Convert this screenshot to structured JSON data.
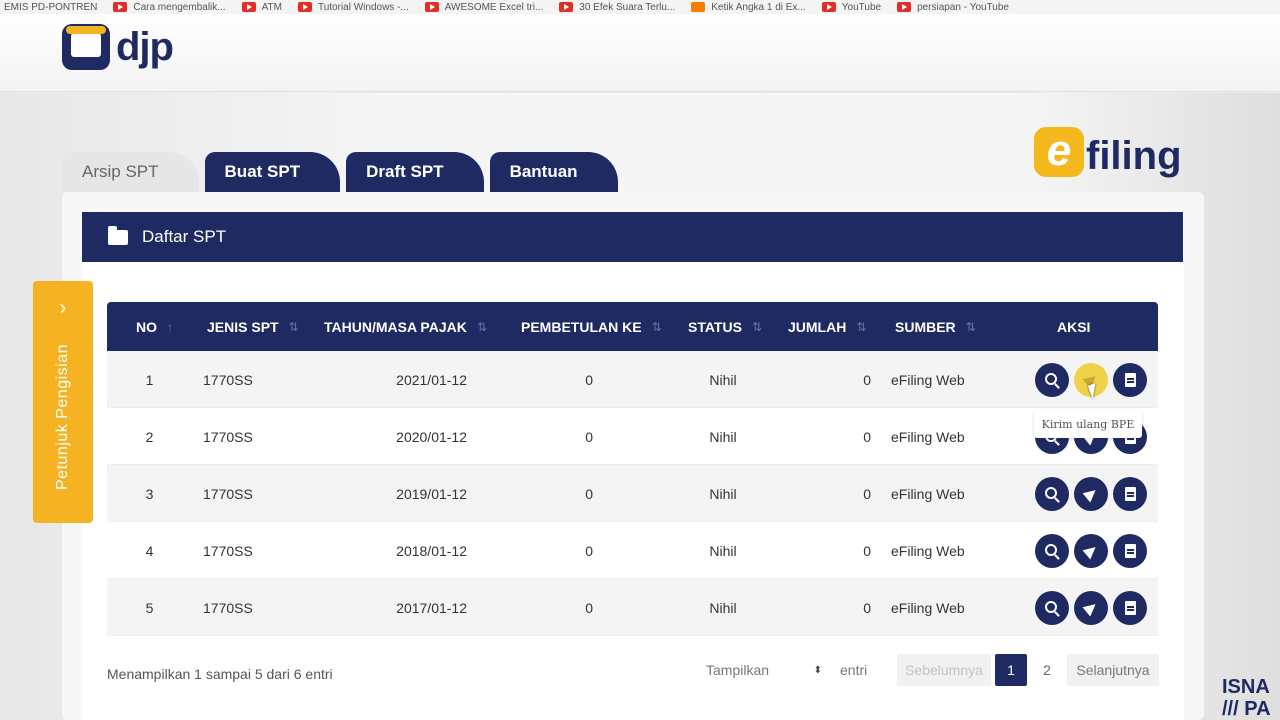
{
  "bookmarks": [
    {
      "label": "EMIS PD-PONTREN",
      "icon": "none"
    },
    {
      "label": "Cara mengembalik...",
      "icon": "youtube"
    },
    {
      "label": "ATM",
      "icon": "youtube"
    },
    {
      "label": "Tutorial Windows -...",
      "icon": "youtube"
    },
    {
      "label": "AWESOME Excel tri...",
      "icon": "youtube"
    },
    {
      "label": "30 Efek Suara Terlu...",
      "icon": "youtube"
    },
    {
      "label": "Ketik Angka 1 di Ex...",
      "icon": "blogger"
    },
    {
      "label": "YouTube",
      "icon": "youtube"
    },
    {
      "label": "persiapan - YouTube",
      "icon": "youtube"
    }
  ],
  "header": {
    "logo_text": "djp",
    "efiling_e": "e",
    "efiling_text": "filing"
  },
  "tabs": [
    {
      "label": "Arsip SPT",
      "active": true
    },
    {
      "label": "Buat SPT",
      "active": false
    },
    {
      "label": "Draft SPT",
      "active": false
    },
    {
      "label": "Bantuan",
      "active": false
    }
  ],
  "side_tab": {
    "arrow": "›",
    "label": "Petunjuk Pengisian"
  },
  "panel": {
    "title": "Daftar SPT"
  },
  "table": {
    "columns": {
      "no": "NO",
      "jenis": "JENIS SPT",
      "tahun": "TAHUN/MASA PAJAK",
      "pembetulan": "PEMBETULAN KE",
      "status": "STATUS",
      "jumlah": "JUMLAH",
      "sumber": "SUMBER",
      "aksi": "AKSI"
    },
    "rows": [
      {
        "no": "1",
        "jenis": "1770SS",
        "tahun": "2021/01-12",
        "pembetulan": "0",
        "status": "Nihil",
        "jumlah": "0",
        "sumber": "eFiling Web"
      },
      {
        "no": "2",
        "jenis": "1770SS",
        "tahun": "2020/01-12",
        "pembetulan": "0",
        "status": "Nihil",
        "jumlah": "0",
        "sumber": "eFiling Web"
      },
      {
        "no": "3",
        "jenis": "1770SS",
        "tahun": "2019/01-12",
        "pembetulan": "0",
        "status": "Nihil",
        "jumlah": "0",
        "sumber": "eFiling Web"
      },
      {
        "no": "4",
        "jenis": "1770SS",
        "tahun": "2018/01-12",
        "pembetulan": "0",
        "status": "Nihil",
        "jumlah": "0",
        "sumber": "eFiling Web"
      },
      {
        "no": "5",
        "jenis": "1770SS",
        "tahun": "2017/01-12",
        "pembetulan": "0",
        "status": "Nihil",
        "jumlah": "0",
        "sumber": "eFiling Web"
      }
    ],
    "action_icons": [
      "search-icon",
      "send-icon",
      "document-icon"
    ],
    "tooltip": "Kirim ulang BPE"
  },
  "footer": {
    "info": "Menampilkan 1 sampai 5 dari 6 entri",
    "show_label": "Tampilkan",
    "select_arrow": "⬍",
    "entries_label": "entri",
    "prev": "Sebelumnya",
    "page1": "1",
    "page2": "2",
    "next": "Selanjutnya"
  },
  "watermark": "ISNAINI PANGLIMA",
  "corner_mark": "ISNA\n/// PA",
  "colors": {
    "primary": "#1f2a63",
    "accent": "#f5b323"
  }
}
